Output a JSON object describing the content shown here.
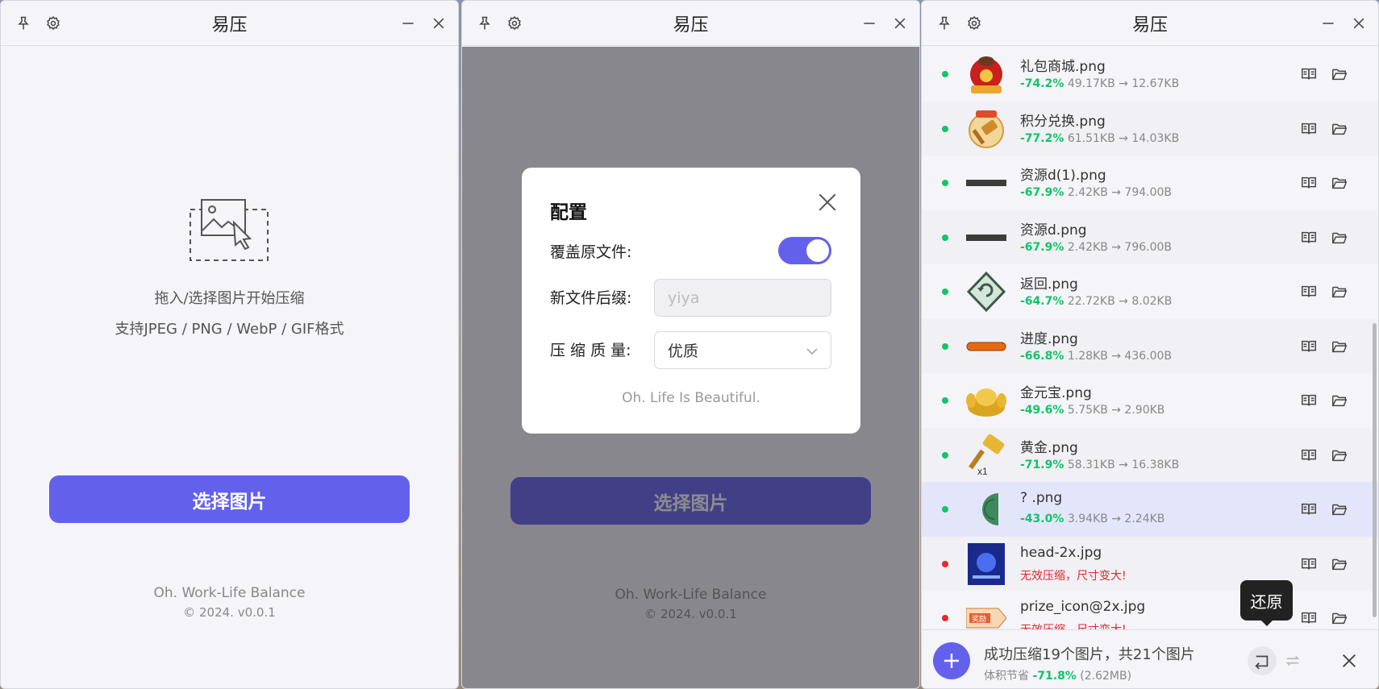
{
  "app": {
    "title": "易压"
  },
  "home": {
    "hint_line1": "拖入/选择图片开始压缩",
    "hint_line2": "支持JPEG / PNG / WebP / GIF格式",
    "select_button": "选择图片",
    "footer_line1": "Oh. Work-Life Balance",
    "footer_line2": "© 2024. v0.0.1"
  },
  "config": {
    "title": "配置",
    "overwrite_label": "覆盖原文件:",
    "overwrite_enabled": true,
    "suffix_label": "新文件后缀:",
    "suffix_placeholder": "yiya",
    "quality_label": "压 缩 质 量:",
    "quality_value": "优质",
    "footer": "Oh. Life Is Beautiful."
  },
  "files": [
    {
      "name": "礼包商城.png",
      "status": "ok",
      "percent": "-74.2%",
      "sizes": "49.17KB → 12.67KB",
      "thumb": "gift-bag"
    },
    {
      "name": "积分兑换.png",
      "status": "ok",
      "percent": "-77.2%",
      "sizes": "61.51KB → 14.03KB",
      "thumb": "hammer-badge"
    },
    {
      "name": "资源d(1).png",
      "status": "ok",
      "percent": "-67.9%",
      "sizes": "2.42KB → 794.00B",
      "thumb": "dark-bar"
    },
    {
      "name": "资源d.png",
      "status": "ok",
      "percent": "-67.9%",
      "sizes": "2.42KB → 796.00B",
      "thumb": "dark-bar"
    },
    {
      "name": "返回.png",
      "status": "ok",
      "percent": "-64.7%",
      "sizes": "22.72KB → 8.02KB",
      "thumb": "return-diamond"
    },
    {
      "name": "进度.png",
      "status": "ok",
      "percent": "-66.8%",
      "sizes": "1.28KB → 436.00B",
      "thumb": "orange-bar"
    },
    {
      "name": "金元宝.png",
      "status": "ok",
      "percent": "-49.6%",
      "sizes": "5.75KB → 2.90KB",
      "thumb": "gold-ingot"
    },
    {
      "name": "黄金.png",
      "status": "ok",
      "percent": "-71.9%",
      "sizes": "58.31KB → 16.38KB",
      "thumb": "gold-hammer",
      "thumb_text": "x1"
    },
    {
      "name": "?  .png",
      "status": "ok",
      "percent": "-43.0%",
      "sizes": "3.94KB → 2.24KB",
      "thumb": "green-half-coin"
    },
    {
      "name": "head-2x.jpg",
      "status": "error",
      "error_text": "无效压缩，尺寸变大!",
      "thumb": "blue-poster"
    },
    {
      "name": "prize_icon@2x.jpg",
      "status": "error",
      "error_text": "无效压缩，尺寸变大!",
      "thumb": "prize-tag",
      "thumb_text": "奖励"
    }
  ],
  "summary": {
    "line1": "成功压缩19个图片，共21个图片",
    "saved_prefix": "体积节省",
    "saved_percent": "-71.8%",
    "saved_size": "(2.62MB)"
  },
  "tooltip": {
    "restore": "还原"
  },
  "colors": {
    "accent": "#6361ec",
    "success": "#13c466",
    "error": "#e0282e",
    "window_bg": "#f4f4f9"
  }
}
